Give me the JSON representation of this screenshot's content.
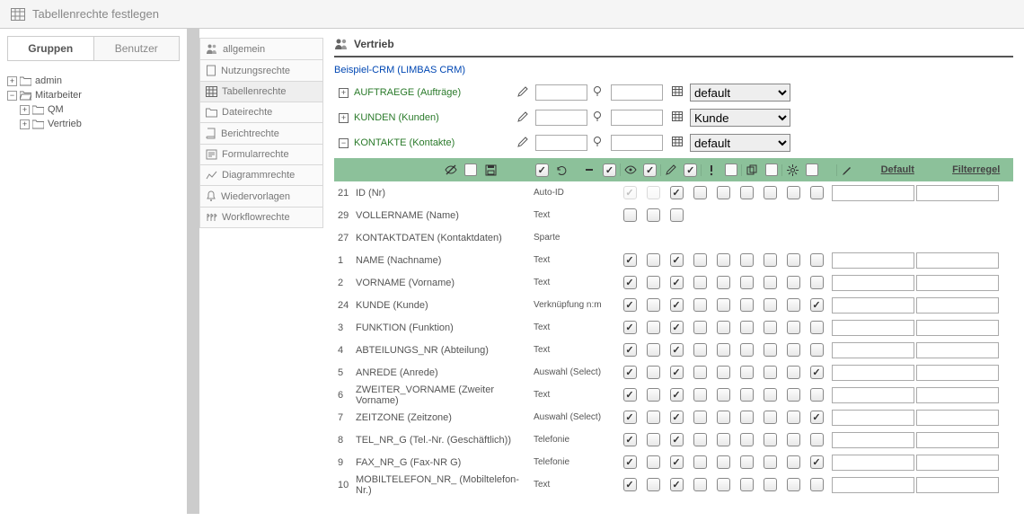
{
  "header": {
    "title": "Tabellenrechte festlegen"
  },
  "sidebar": {
    "tabs": {
      "groups": "Gruppen",
      "users": "Benutzer"
    },
    "tree": [
      {
        "label": "admin",
        "expand": "+",
        "lvl": 1
      },
      {
        "label": "Mitarbeiter",
        "expand": "−",
        "lvl": 1
      },
      {
        "label": "QM",
        "expand": "+",
        "lvl": 2
      },
      {
        "label": "Vertrieb",
        "expand": "+",
        "lvl": 2
      }
    ]
  },
  "menu": [
    {
      "label": "allgemein",
      "icon": "users"
    },
    {
      "label": "Nutzungsrechte",
      "icon": "page"
    },
    {
      "label": "Tabellenrechte",
      "icon": "table",
      "active": true
    },
    {
      "label": "Dateirechte",
      "icon": "folder"
    },
    {
      "label": "Berichtrechte",
      "icon": "book"
    },
    {
      "label": "Formularrechte",
      "icon": "form"
    },
    {
      "label": "Diagrammrechte",
      "icon": "chart"
    },
    {
      "label": "Wiedervorlagen",
      "icon": "bell"
    },
    {
      "label": "Workflowrechte",
      "icon": "flow"
    }
  ],
  "main": {
    "section": "Vertrieb",
    "crumb": "Beispiel-CRM (LIMBAS CRM)",
    "groups": [
      {
        "expand": "+",
        "label": "AUFTRAEGE (Aufträge)",
        "select": "default"
      },
      {
        "expand": "+",
        "label": "KUNDEN (Kunden)",
        "select": "Kunde"
      },
      {
        "expand": "−",
        "label": "KONTAKTE (Kontakte)",
        "select": "default"
      }
    ],
    "cols": {
      "default": "Default",
      "filter": "Filterregel"
    },
    "rows": [
      {
        "id": "21",
        "name": "ID (Nr)",
        "type": "Auto-ID",
        "cb": [
          1,
          0,
          1,
          0,
          0,
          0,
          0,
          0,
          0
        ],
        "ghost": true,
        "inputs": true
      },
      {
        "id": "29",
        "name": "VOLLERNAME (Name)",
        "type": "Text",
        "cb": [
          0,
          0,
          0,
          -1,
          -1,
          -1,
          -1,
          -1,
          -1
        ],
        "inputs": false
      },
      {
        "id": "27",
        "name": "KONTAKTDATEN (Kontaktdaten)",
        "type": "Sparte",
        "cb": [
          -1,
          -1,
          -1,
          -1,
          -1,
          -1,
          -1,
          -1,
          -1
        ],
        "inputs": false
      },
      {
        "id": "1",
        "name": "NAME (Nachname)",
        "type": "Text",
        "cb": [
          1,
          0,
          1,
          0,
          0,
          0,
          0,
          0,
          0
        ],
        "inputs": true
      },
      {
        "id": "2",
        "name": "VORNAME (Vorname)",
        "type": "Text",
        "cb": [
          1,
          0,
          1,
          0,
          0,
          0,
          0,
          0,
          0
        ],
        "inputs": true
      },
      {
        "id": "24",
        "name": "KUNDE (Kunde)",
        "type": "Verknüpfung n:m",
        "cb": [
          1,
          0,
          1,
          0,
          0,
          0,
          0,
          0,
          1
        ],
        "inputs": true
      },
      {
        "id": "3",
        "name": "FUNKTION (Funktion)",
        "type": "Text",
        "cb": [
          1,
          0,
          1,
          0,
          0,
          0,
          0,
          0,
          0
        ],
        "inputs": true
      },
      {
        "id": "4",
        "name": "ABTEILUNGS_NR (Abteilung)",
        "type": "Text",
        "cb": [
          1,
          0,
          1,
          0,
          0,
          0,
          0,
          0,
          0
        ],
        "inputs": true
      },
      {
        "id": "5",
        "name": "ANREDE (Anrede)",
        "type": "Auswahl (Select)",
        "cb": [
          1,
          0,
          1,
          0,
          0,
          0,
          0,
          0,
          1
        ],
        "inputs": true
      },
      {
        "id": "6",
        "name": "ZWEITER_VORNAME (Zweiter Vorname)",
        "type": "Text",
        "cb": [
          1,
          0,
          1,
          0,
          0,
          0,
          0,
          0,
          0
        ],
        "inputs": true
      },
      {
        "id": "7",
        "name": "ZEITZONE (Zeitzone)",
        "type": "Auswahl (Select)",
        "cb": [
          1,
          0,
          1,
          0,
          0,
          0,
          0,
          0,
          1
        ],
        "inputs": true
      },
      {
        "id": "8",
        "name": "TEL_NR_G (Tel.-Nr. (Geschäftlich))",
        "type": "Telefonie",
        "cb": [
          1,
          0,
          1,
          0,
          0,
          0,
          0,
          0,
          0
        ],
        "inputs": true
      },
      {
        "id": "9",
        "name": "FAX_NR_G (Fax-NR G)",
        "type": "Telefonie",
        "cb": [
          1,
          0,
          1,
          0,
          0,
          0,
          0,
          0,
          1
        ],
        "inputs": true
      },
      {
        "id": "10",
        "name": "MOBILTELEFON_NR_ (Mobiltelefon-Nr.)",
        "type": "Text",
        "cb": [
          1,
          0,
          1,
          0,
          0,
          0,
          0,
          0,
          0
        ],
        "inputs": true
      }
    ]
  }
}
